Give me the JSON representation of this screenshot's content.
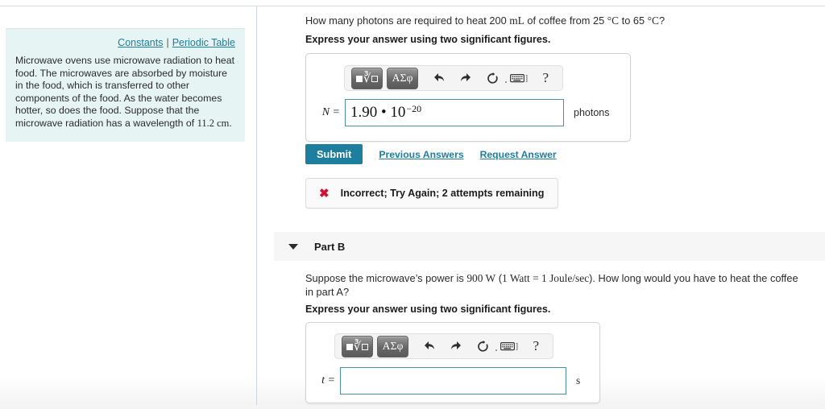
{
  "sidebar": {
    "links": [
      {
        "label": "Constants",
        "name": "constants-link"
      },
      {
        "label": "Periodic Table",
        "name": "periodic-table-link"
      }
    ],
    "separator": "|",
    "intro_text_part1": "Microwave ovens use microwave radiation to heat food. The microwaves are absorbed by moisture in the food, which is transferred to other components of the food. As the water becomes hotter, so does the food. Suppose that the microwave radiation has a wavelength of ",
    "intro_wavelength": "11.2 cm",
    "intro_text_part2": "."
  },
  "part_a": {
    "question_pre": "How many photons are required to heat 200 ",
    "question_unit_volume": "mL",
    "question_mid": " of coffee from 25 ",
    "question_temp1": "°C",
    "question_mid2": " to 65 ",
    "question_temp2": "°C",
    "question_end": "?",
    "instruction": "Express your answer using two significant figures.",
    "toolbar": {
      "template_button": "math-template",
      "greek_button": "ΑΣφ",
      "undo": "undo-icon",
      "redo": "redo-icon",
      "reset": "reset-icon",
      "keyboard": "keyboard-icon",
      "keyboard_tail": "]",
      "help": "?"
    },
    "variable_label": "N =",
    "answer_mantissa": "1.90 • 10",
    "answer_exponent": "−20",
    "unit": "photons",
    "submit_label": "Submit",
    "previous_answers_label": "Previous Answers",
    "request_answer_label": "Request Answer",
    "feedback": {
      "icon": "x-mark-icon",
      "text": "Incorrect; Try Again; 2 attempts remaining"
    }
  },
  "part_b": {
    "header_title": "Part B",
    "caret": "caret-down-icon",
    "question_pre": "Suppose the microwave’s power is ",
    "question_power": "900 W",
    "question_paren_open": " (",
    "question_equation": "1 Watt = 1 Joule/sec",
    "question_paren_close": "). How long would you have to heat the coffee in part A?",
    "instruction": "Express your answer using two significant figures.",
    "toolbar": {
      "template_button": "math-template",
      "greek_button": "ΑΣφ",
      "undo": "undo-icon",
      "redo": "redo-icon",
      "reset": "reset-icon",
      "keyboard": "keyboard-icon",
      "keyboard_tail": "]",
      "help": "?"
    },
    "variable_label": "t =",
    "answer_value": "",
    "unit": "s"
  },
  "colors": {
    "accent_teal": "#1d7e9e",
    "info_box_bg": "#e6f4f3",
    "error_red": "#d50f32",
    "field_border": "#4a90a8",
    "part_header_bg": "#f6f6f6"
  }
}
